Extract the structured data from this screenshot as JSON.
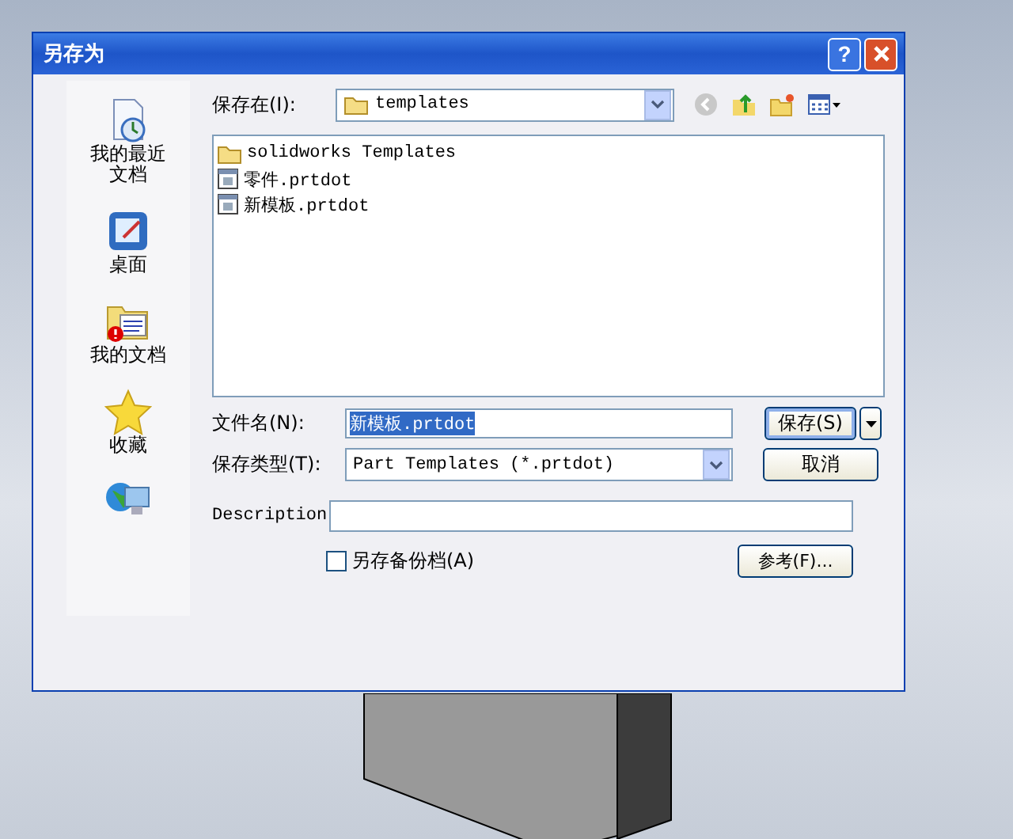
{
  "window": {
    "title": "另存为",
    "help_button": "?"
  },
  "places": [
    {
      "label": "我的最近文档",
      "kind": "recent"
    },
    {
      "label": "桌面",
      "kind": "desktop"
    },
    {
      "label": "我的文档",
      "kind": "documents"
    },
    {
      "label": "收藏",
      "kind": "favorites"
    },
    {
      "kind": "network"
    }
  ],
  "save_in": {
    "label": "保存在(I):",
    "value": "templates"
  },
  "files": [
    {
      "name": "solidworks Templates",
      "kind": "folder"
    },
    {
      "name": "零件.prtdot",
      "kind": "document"
    },
    {
      "name": "新模板.prtdot",
      "kind": "document"
    }
  ],
  "file_name": {
    "label": "文件名(N):",
    "value": "新模板.prtdot",
    "selected": true
  },
  "save_type": {
    "label": "保存类型(T):",
    "value": "Part Templates (*.prtdot)"
  },
  "description": {
    "label": "Description"
  },
  "backup": {
    "label": "另存备份档(A)",
    "checked": false
  },
  "buttons": {
    "save": "保存(S)",
    "cancel": "取消",
    "browse": "参考(F)..."
  }
}
